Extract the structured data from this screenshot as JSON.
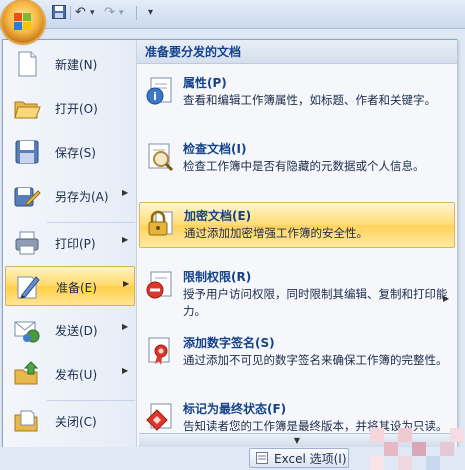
{
  "toolbar": {
    "undo": "↶",
    "redo": "↷",
    "dropdown": "▾",
    "customize": "▾"
  },
  "menu": {
    "commands": [
      {
        "label": "新建(N)",
        "icon": "new-doc-icon",
        "arrow": ""
      },
      {
        "label": "打开(O)",
        "icon": "open-folder-icon",
        "arrow": ""
      },
      {
        "label": "保存(S)",
        "icon": "save-disk-icon",
        "arrow": ""
      },
      {
        "label": "另存为(A)",
        "icon": "save-as-icon",
        "arrow": "▶"
      },
      {
        "label": "打印(P)",
        "icon": "printer-icon",
        "arrow": "▶"
      },
      {
        "label": "准备(E)",
        "icon": "prepare-icon",
        "arrow": "▶"
      },
      {
        "label": "发送(D)",
        "icon": "send-icon",
        "arrow": "▶"
      },
      {
        "label": "发布(U)",
        "icon": "publish-icon",
        "arrow": "▶"
      },
      {
        "label": "关闭(C)",
        "icon": "close-folder-icon",
        "arrow": ""
      }
    ],
    "selected_command": "准备(E)"
  },
  "panel": {
    "heading": "准备要分发的文档",
    "items": [
      {
        "title": "属性(P)",
        "desc": "查看和编辑工作簿属性，如标题、作者和关键字。",
        "icon": "properties-icon"
      },
      {
        "title": "检查文档(I)",
        "desc": "检查工作簿中是否有隐藏的元数据或个人信息。",
        "icon": "inspect-document-icon"
      },
      {
        "title": "加密文档(E)",
        "desc": "通过添加加密增强工作簿的安全性。",
        "icon": "encrypt-lock-icon"
      },
      {
        "title": "限制权限(R)",
        "desc": "授予用户访问权限，同时限制其编辑、复制和打印能力。",
        "icon": "restrict-permission-icon",
        "arrow": "▶"
      },
      {
        "title": "添加数字签名(S)",
        "desc": "通过添加不可见的数字签名来确保工作簿的完整性。",
        "icon": "digital-signature-icon"
      },
      {
        "title": "标记为最终状态(F)",
        "desc": "告知读者您的工作簿是最终版本，并将其设为只读。",
        "icon": "mark-final-icon"
      }
    ],
    "highlighted_item": "加密文档(E)",
    "scroll_down": "▼"
  },
  "footer": {
    "excel_options": "Excel 选项(I)"
  },
  "colors": {
    "highlight": "#ffd96a",
    "title_blue": "#15428b",
    "panel_bg": "#f5f7fb"
  }
}
